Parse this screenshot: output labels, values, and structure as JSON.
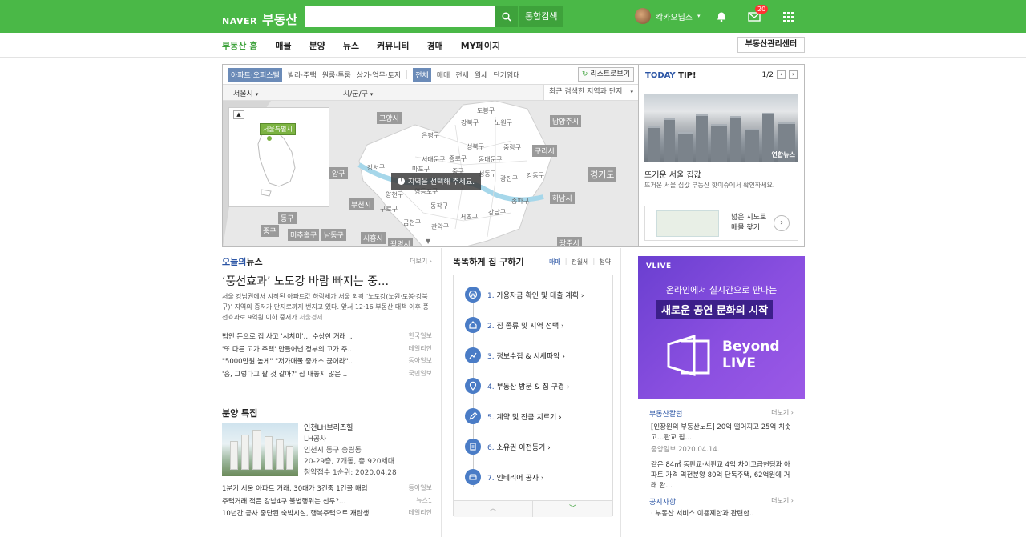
{
  "header": {
    "naver": "NAVER",
    "service": "부동산",
    "search_placeholder": "",
    "total_search": "통합검색",
    "user_name": "칵카오닙스",
    "mail_count": "20"
  },
  "nav": {
    "items": [
      "부동산 홈",
      "매물",
      "분양",
      "뉴스",
      "커뮤니티",
      "경매",
      "MY페이지"
    ],
    "right": "부동산관리센터"
  },
  "map": {
    "property_tabs": [
      "아파트·오피스텔",
      "빌라·주택",
      "원룸·투룸",
      "상가·업무·토지"
    ],
    "deal_tabs": [
      "전체",
      "매매",
      "전세",
      "월세",
      "단기임대"
    ],
    "list_btn": "리스트로보기",
    "region1": "서울시",
    "region2": "시/군/구",
    "recent": "최근 검색한 지역과 단지",
    "mini_label": "서울특별시",
    "tooltip": "지역을 선택해 주세요.",
    "outer_labels": [
      "고양시",
      "남양주시",
      "구리시",
      "하남시",
      "경기도",
      "부천시",
      "시흥시",
      "광명시",
      "미추홀구",
      "남동구",
      "동구",
      "중구",
      "광주시",
      "양구"
    ],
    "districts": [
      "도봉구",
      "강북구",
      "노원구",
      "은평구",
      "성북구",
      "중랑구",
      "종로구",
      "동대문구",
      "서대문구",
      "마포구",
      "중구",
      "성동구",
      "광진구",
      "강동구",
      "강서구",
      "양천구",
      "영등포구",
      "동작구",
      "구로구",
      "금천구",
      "관악구",
      "서초구",
      "강남구",
      "송파구"
    ]
  },
  "tip": {
    "today": "TODAY",
    "tip": "TIP!",
    "pager": "1/2",
    "watermark": "연합뉴스",
    "title": "뜨거운 서울 집값",
    "desc": "뜨거운 서울 집값 부동산 핫이슈에서 확인하세요.",
    "card_line1": "넓은 지도로",
    "card_line2": "매물 찾기"
  },
  "news": {
    "title_prefix": "오늘의",
    "title": "뉴스",
    "more": "더보기",
    "headline": "‘풍선효과’ 노도강 바람 빠지는 중…",
    "body": "서울 강남권에서 시작된 아파트값 하락세가 서울 외곽 ‘노도강(노원·도봉·강북구)’ 지역의 중저가 단지로까지 번지고 있다. 앞서 12·16 부동산 대책 이후 풍선효과로 9억원 이하 중저가",
    "body_src": "서울경제",
    "list": [
      {
        "t": "법인 돈으로 집 사고 '시치미'… 수상한 거래 ..",
        "s": "한국일보"
      },
      {
        "t": "'또 다른 고가 주택' 만들어낸 정부의 고가 주..",
        "s": "데일리안"
      },
      {
        "t": "\"5000만원 높게\" \"저가매물 중개소 끊어라\"..",
        "s": "동아일보"
      },
      {
        "t": "'흥, 그렇다고 팔 것 같아?' 집 내놓지 않은 ..",
        "s": "국민일보"
      }
    ]
  },
  "sale": {
    "title": "분양 특집",
    "name": "인천LH브리즈힐",
    "company": "LH공사",
    "address": "인천시 동구 송림동",
    "spec": "20-29층, 7개동, 총 920세대",
    "date": "청약접수 1순위: 2020.04.28",
    "list": [
      {
        "t": "1분기 서울 아파트 거래, 30대가 3건중 1건꼴 매입",
        "s": "동아일보"
      },
      {
        "t": "주택거래 적은 강남4구 불법행위는 선두?…",
        "s": "뉴스1"
      },
      {
        "t": "10년간 공사 중단된 숙박시설, 행복주택으로 재탄생",
        "s": "데일리안"
      }
    ]
  },
  "steps": {
    "title": "똑똑하게 집 구하기",
    "tabs": [
      "매매",
      "전월세",
      "청약"
    ],
    "items": [
      {
        "n": "1.",
        "t": "가용자금 확인 및 대출 계획"
      },
      {
        "n": "2.",
        "t": "집 종류 및 지역 선택"
      },
      {
        "n": "3.",
        "t": "정보수집 & 시세파악"
      },
      {
        "n": "4.",
        "t": "부동산 방문 & 집 구경"
      },
      {
        "n": "5.",
        "t": "계약 및 잔금 치르기"
      },
      {
        "n": "6.",
        "t": "소유권 이전등기"
      },
      {
        "n": "7.",
        "t": "인테리어 공사"
      }
    ]
  },
  "banner": {
    "brand": "VLIVE",
    "line1": "온라인에서 실시간으로 만나는",
    "line2": "새로운 공연 문화의 시작",
    "beyond1": "Beyond",
    "beyond2": "LIVE"
  },
  "side": {
    "column_title": "부동산칼럼",
    "more": "더보기",
    "col1": "[인장원의 부동산노트] 20억 떨어지고 25억 치솟고…판교 집…",
    "col1_meta": "중앙일보 2020.04.14.",
    "col2": "같은 84㎡ 동판교·서판교 4억 차이고급헌팅과 아파트 가격 역전분양 80억 단독주택, 62억원에 거래 완…",
    "notice_title": "공지사항",
    "notice_more": "더보기",
    "notice1": "부동산 서비스 이용제한과 관련한.."
  },
  "colors": {
    "brand": "#4ab847",
    "accent": "#2b55a5",
    "banner": "#7b4ad8"
  }
}
